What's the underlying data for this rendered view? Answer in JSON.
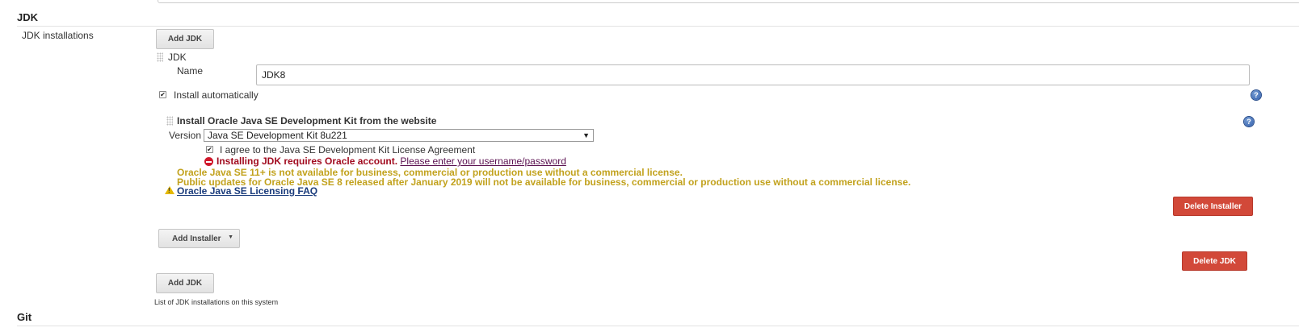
{
  "sections": {
    "jdk": "JDK",
    "git": "Git"
  },
  "jdk_installations": {
    "label": "JDK installations",
    "add_jdk_label": "Add JDK",
    "help_text": "List of JDK installations on this system",
    "delete_jdk_label": "Delete JDK",
    "entry": {
      "title": "JDK",
      "name_label": "Name",
      "name_value": "JDK8",
      "install_auto_label": "Install automatically",
      "install_auto_checked": true,
      "add_installer_label": "Add Installer"
    },
    "installer": {
      "title": "Install Oracle Java SE Development Kit from the website",
      "version_label": "Version",
      "version_value": "Java SE Development Kit 8u221",
      "agree_label": "I agree to the Java SE Development Kit License Agreement",
      "agree_checked": true,
      "error_text": "Installing JDK requires Oracle account.",
      "error_link": "Please enter your username/password",
      "warning_line1": "Oracle Java SE 11+ is not available for business, commercial or production use without a commercial license.",
      "warning_line2": "Public updates for Oracle Java SE 8 released after January 2019 will not be available for business, commercial or production use without a commercial license.",
      "faq_link": "Oracle Java SE Licensing FAQ",
      "delete_installer_label": "Delete Installer"
    }
  },
  "icons": {
    "help": "?",
    "check": "✔",
    "dropdown": "▼",
    "warning": "!"
  },
  "colors": {
    "delete_button": "#d24939",
    "error_text": "#a10b1f",
    "warning_text": "#c2a21d"
  }
}
